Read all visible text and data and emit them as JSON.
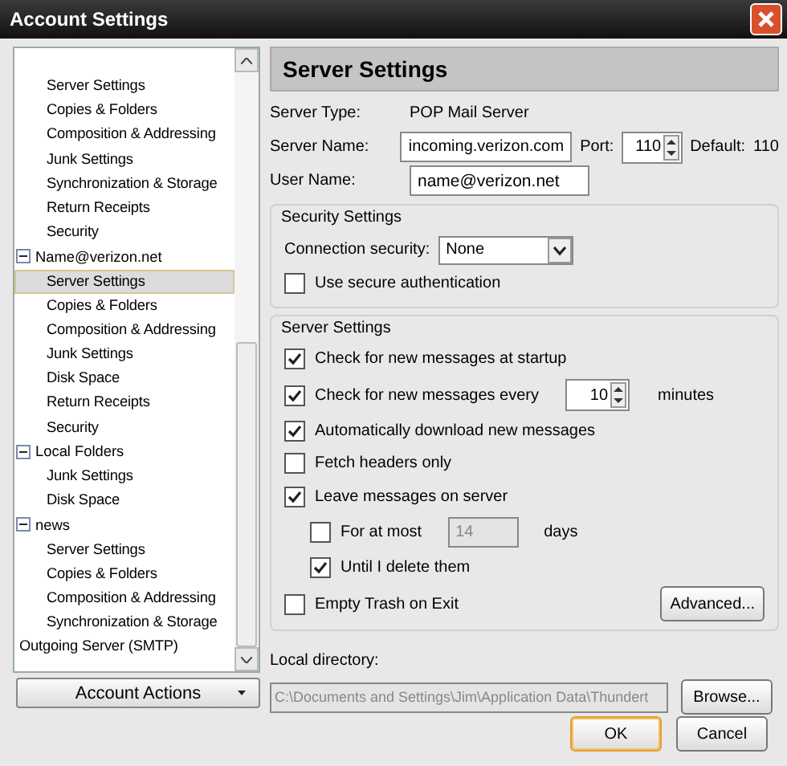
{
  "window": {
    "title": "Account Settings"
  },
  "tree": [
    {
      "children": [
        {
          "label": "Server Settings",
          "selected": false
        },
        {
          "label": "Copies & Folders",
          "selected": false
        },
        {
          "label": "Composition & Addressing",
          "selected": false
        },
        {
          "label": "Junk Settings",
          "selected": false
        },
        {
          "label": "Synchronization & Storage",
          "selected": false
        },
        {
          "label": "Return Receipts",
          "selected": false
        },
        {
          "label": "Security",
          "selected": false
        }
      ]
    },
    {
      "label": "Name@verizon.net",
      "expanded": true,
      "selected": false,
      "children": [
        {
          "label": "Server Settings",
          "selected": true
        },
        {
          "label": "Copies & Folders",
          "selected": false
        },
        {
          "label": "Composition & Addressing",
          "selected": false
        },
        {
          "label": "Junk Settings",
          "selected": false
        },
        {
          "label": "Disk Space",
          "selected": false
        },
        {
          "label": "Return Receipts",
          "selected": false
        },
        {
          "label": "Security",
          "selected": false
        }
      ]
    },
    {
      "label": "Local Folders",
      "expanded": true,
      "selected": false,
      "children": [
        {
          "label": "Junk Settings",
          "selected": false
        },
        {
          "label": "Disk Space",
          "selected": false
        }
      ]
    },
    {
      "label": "news",
      "expanded": true,
      "selected": false,
      "children": [
        {
          "label": "Server Settings",
          "selected": false
        },
        {
          "label": "Copies & Folders",
          "selected": false
        },
        {
          "label": "Composition & Addressing",
          "selected": false
        },
        {
          "label": "Synchronization & Storage",
          "selected": false
        }
      ]
    },
    {
      "label": "Outgoing Server (SMTP)",
      "selected": false
    }
  ],
  "account_actions": "Account Actions",
  "panel": {
    "title": "Server Settings",
    "server_type_label": "Server Type:",
    "server_type": "POP Mail Server",
    "server_name_label": "Server Name:",
    "server_name": "incoming.verizon.com",
    "port_label": "Port:",
    "port": "110",
    "default_label": "Default:",
    "default": "110",
    "user_name_label": "User Name:",
    "user_name": "name@verizon.net",
    "security": {
      "title": "Security Settings",
      "connection_label": "Connection security:",
      "connection": "None",
      "secure_auth": {
        "label": "Use secure authentication",
        "checked": false
      }
    },
    "server": {
      "title": "Server Settings",
      "options": [
        {
          "kind": "check",
          "label": "Check for new messages at startup",
          "checked": true
        },
        {
          "kind": "interval",
          "label": "Check for new messages every",
          "checked": true,
          "value": "10",
          "unit": "minutes"
        },
        {
          "kind": "check",
          "label": "Automatically download new messages",
          "checked": true
        },
        {
          "kind": "check",
          "label": "Fetch headers only",
          "checked": false
        },
        {
          "kind": "check",
          "label": "Leave messages on server",
          "checked": true
        },
        {
          "kind": "days",
          "label": "For at most",
          "checked": false,
          "value": "14",
          "unit": "days",
          "disabled": true
        },
        {
          "kind": "sub",
          "label": "Until I delete them",
          "checked": true
        },
        {
          "kind": "advanced",
          "label": "Empty Trash on Exit",
          "checked": false,
          "button": "Advanced..."
        }
      ]
    },
    "local_dir_label": "Local directory:",
    "local_dir": "C:\\Documents and Settings\\Jim\\Application Data\\Thundert",
    "browse": "Browse..."
  },
  "buttons": [
    {
      "label": "OK",
      "default": true
    },
    {
      "label": "Cancel",
      "default": false
    }
  ]
}
